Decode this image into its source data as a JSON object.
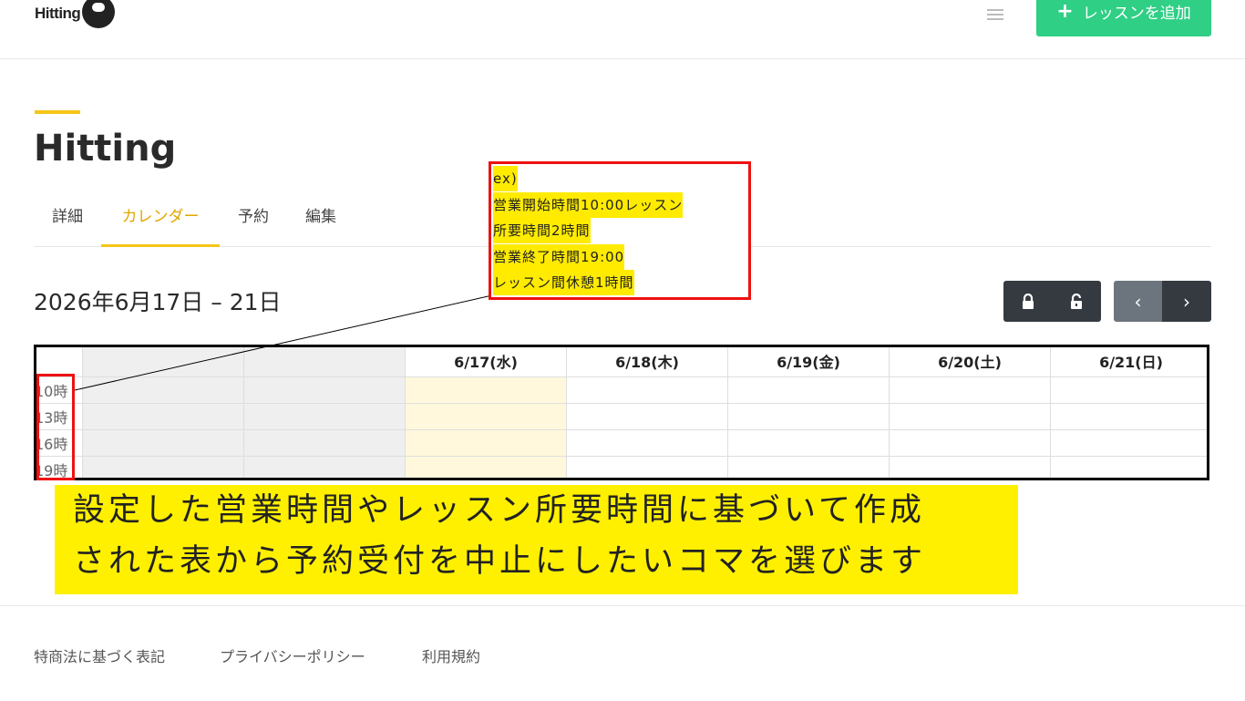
{
  "header": {
    "logo_text": "Hitting",
    "add_button_label": "レッスンを追加"
  },
  "page": {
    "title": "Hitting",
    "tabs": [
      {
        "label": "詳細"
      },
      {
        "label": "カレンダー"
      },
      {
        "label": "予約"
      },
      {
        "label": "編集"
      }
    ],
    "active_tab": "カレンダー",
    "date_range": "2026年6月17日 – 21日"
  },
  "calendar": {
    "days": [
      "6/17(水)",
      "6/18(木)",
      "6/19(金)",
      "6/20(土)",
      "6/21(日)"
    ],
    "times": [
      "10時",
      "13時",
      "16時",
      "19時"
    ]
  },
  "annotation": {
    "lines": [
      "ex)",
      "営業開始時間10:00レッスン",
      "所要時間2時間",
      "営業終了時間19:00",
      "レッスン間休憩1時間"
    ]
  },
  "caption": {
    "line1": "設定した営業時間やレッスン所要時間に基づいて作成",
    "line2": "された表から予約受付を中止にしたいコマを選びます"
  },
  "footer": {
    "links": [
      "特商法に基づく表記",
      "プライバシーポリシー",
      "利用規約"
    ]
  },
  "colors": {
    "accent": "#f5c518",
    "add_button": "#2fcf85",
    "highlight": "#ffeb00",
    "annotation_border": "#e11111"
  }
}
